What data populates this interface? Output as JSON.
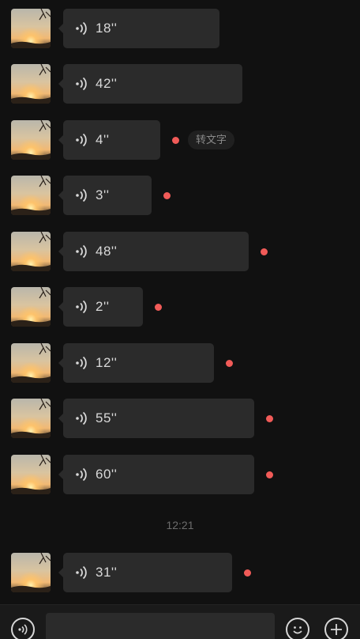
{
  "messages": [
    {
      "duration": "18''",
      "unread": false
    },
    {
      "duration": "42''",
      "unread": false
    },
    {
      "duration": "4''",
      "unread": true,
      "to_text_label": "转文字"
    },
    {
      "duration": "3''",
      "unread": true
    },
    {
      "duration": "48''",
      "unread": true
    },
    {
      "duration": "2''",
      "unread": true
    },
    {
      "duration": "12''",
      "unread": true
    },
    {
      "duration": "55''",
      "unread": true
    },
    {
      "duration": "60''",
      "unread": true
    },
    {
      "duration": "31''",
      "unread": true
    }
  ],
  "timestamp": "12:21",
  "input_bar": {
    "voice_icon": "voice-mode-icon",
    "emoji_icon": "emoji-icon",
    "plus_icon": "plus-icon"
  },
  "colors": {
    "background": "#111111",
    "bubble": "#2b2b2b",
    "unread_dot": "#f15b58",
    "text": "#d9d9d9"
  }
}
